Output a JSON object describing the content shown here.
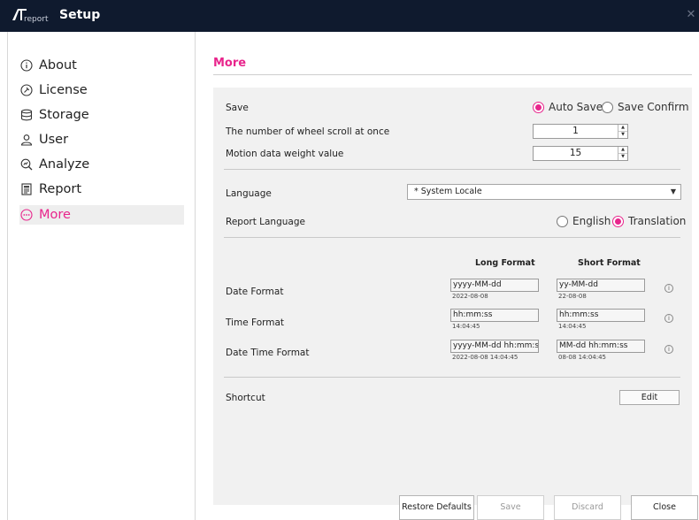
{
  "window": {
    "logo_sub": "report",
    "title": "Setup",
    "close_glyph": "✕"
  },
  "sidebar": {
    "items": [
      {
        "label": "About",
        "icon": "info-circle-icon"
      },
      {
        "label": "License",
        "icon": "license-icon"
      },
      {
        "label": "Storage",
        "icon": "storage-icon"
      },
      {
        "label": "User",
        "icon": "user-icon"
      },
      {
        "label": "Analyze",
        "icon": "analyze-icon"
      },
      {
        "label": "Report",
        "icon": "report-icon"
      },
      {
        "label": "More",
        "icon": "more-icon",
        "active": true
      }
    ]
  },
  "main": {
    "title": "More",
    "save": {
      "label": "Save",
      "options": [
        "Auto Save",
        "Save Confirm"
      ],
      "selected": "Auto Save"
    },
    "wheel_scroll": {
      "label": "The number of wheel scroll at once",
      "value": "1"
    },
    "motion_weight": {
      "label": "Motion data weight value",
      "value": "15"
    },
    "language": {
      "label": "Language",
      "value": "* System Locale"
    },
    "report_language": {
      "label": "Report Language",
      "options": [
        "English",
        "Translation"
      ],
      "selected": "Translation"
    },
    "formats": {
      "long_header": "Long Format",
      "short_header": "Short Format",
      "rows": [
        {
          "label": "Date Format",
          "long": "yyyy-MM-dd",
          "long_example": "2022-08-08",
          "short": "yy-MM-dd",
          "short_example": "22-08-08"
        },
        {
          "label": "Time Format",
          "long": "hh:mm:ss",
          "long_example": "14:04:45",
          "short": "hh:mm:ss",
          "short_example": "14:04:45"
        },
        {
          "label": "Date Time Format",
          "long": "yyyy-MM-dd hh:mm:ss",
          "long_example": "2022-08-08 14:04:45",
          "short": "MM-dd hh:mm:ss",
          "short_example": "08-08 14:04:45"
        }
      ]
    },
    "shortcut": {
      "label": "Shortcut",
      "button": "Edit"
    }
  },
  "footer": {
    "restore": "Restore Defaults",
    "save": "Save",
    "discard": "Discard",
    "close": "Close"
  },
  "colors": {
    "accent": "#e8258c",
    "titlebar": "#0f1a2e",
    "panel": "#f1f1f1"
  }
}
